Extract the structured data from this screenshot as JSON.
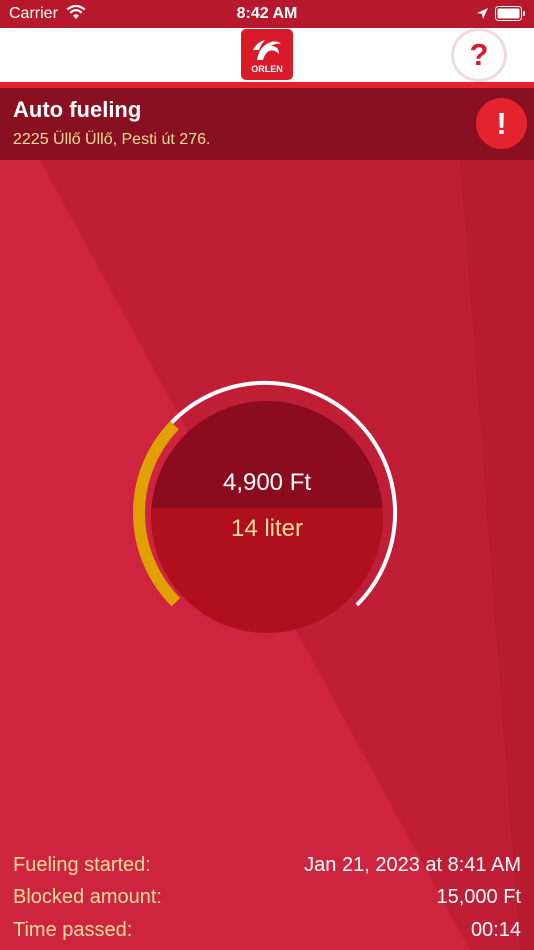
{
  "status_bar": {
    "carrier": "Carrier",
    "time": "8:42 AM"
  },
  "nav": {
    "logo_text": "ORLEN",
    "help_symbol": "?"
  },
  "header": {
    "title": "Auto fueling",
    "address": "2225 Üllő Üllő, Pesti út 276.",
    "alert_symbol": "!"
  },
  "gauge": {
    "amount": "4,900 Ft",
    "liters": "14 liter",
    "progress_fraction": 0.33
  },
  "info": {
    "rows": [
      {
        "label": "Fueling started:",
        "value": "Jan 21, 2023 at 8:41 AM"
      },
      {
        "label": "Blocked amount:",
        "value": "15,000 Ft"
      },
      {
        "label": "Time passed:",
        "value": "00:14"
      }
    ]
  },
  "colors": {
    "brand_red": "#d91a2a",
    "header_bg": "#891020",
    "accent_yellow": "#f7dc9a",
    "progress_orange": "#e0a000"
  }
}
